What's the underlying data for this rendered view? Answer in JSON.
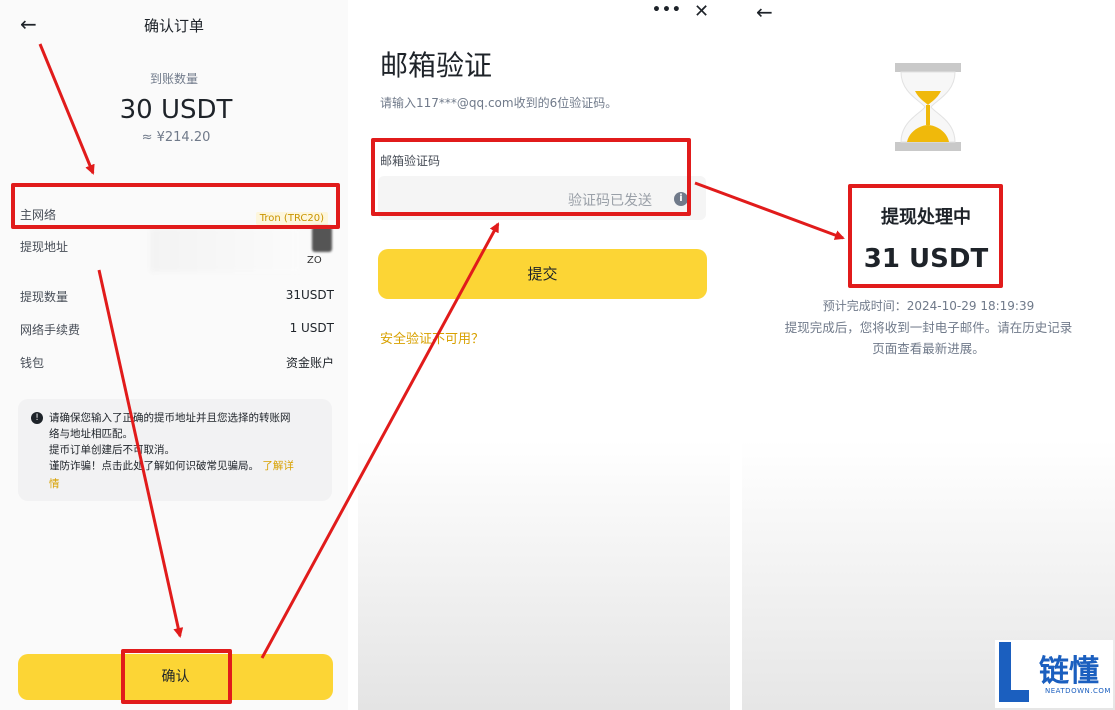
{
  "panel1": {
    "back_icon": "←",
    "title": "确认订单",
    "receive_label": "到账数量",
    "receive_amount": "30 USDT",
    "approx_value": "≈ ¥214.20",
    "rows": [
      {
        "label": "主网络",
        "value": "Tron (TRC20)"
      },
      {
        "label": "提现地址",
        "value": "ZO"
      },
      {
        "label": "提现数量",
        "value": "31USDT"
      },
      {
        "label": "网络手续费",
        "value": "1 USDT"
      },
      {
        "label": "钱包",
        "value": "资金账户"
      }
    ],
    "warning": {
      "line1": "请确保您输入了正确的提币地址并且您选择的转账网",
      "line2": "络与地址相匹配。",
      "line3": "提币订单创建后不可取消。",
      "line4": "谨防诈骗！点击此处了解如何识破常见骗局。",
      "link": "了解详",
      "link2": "情"
    },
    "confirm_button": "确认"
  },
  "panel2": {
    "more_icon": "•••",
    "close_icon": "✕",
    "title": "邮箱验证",
    "subtitle": "请输入117***@qq.com收到的6位验证码。",
    "field_label": "邮箱验证码",
    "code_sent": "验证码已发送",
    "info_icon": "i",
    "submit_button": "提交",
    "unavailable_link": "安全验证不可用？"
  },
  "panel3": {
    "back_icon": "←",
    "status_title": "提现处理中",
    "amount": "31 USDT",
    "eta_label": "预计完成时间：2024-10-29 18:19:39",
    "note_line1": "提现完成后，您将收到一封电子邮件。请在历史记录",
    "note_line2": "页面查看最新进展。"
  },
  "watermark": {
    "logo_text": "链懂",
    "domain": "NEATDOWN.COM"
  },
  "colors": {
    "accent_yellow": "#fcd535",
    "annotation_red": "#e11b1b",
    "link_gold": "#d8a100"
  }
}
